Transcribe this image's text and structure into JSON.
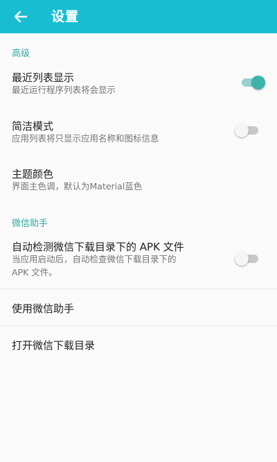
{
  "toolbar": {
    "title": "设置",
    "back_icon": "arrow-left-icon",
    "background": "#19bdd1"
  },
  "sections": {
    "advanced": {
      "header": "高级",
      "recent_list": {
        "title": "最近列表显示",
        "summary": "最近运行程序列表将会显示",
        "enabled": true
      },
      "simple_mode": {
        "title": "简洁模式",
        "summary": "应用列表将只显示应用名称和图标信息",
        "enabled": false
      },
      "theme_color": {
        "title": "主题颜色",
        "summary": "界面主色调，默认为Material蓝色"
      }
    },
    "wechat": {
      "header": "微信助手",
      "auto_detect": {
        "title": "自动检测微信下载目录下的 APK 文件",
        "summary_line1": "当应用启动后，自动检查微信下载目录下的",
        "summary_line2": "APK 文件。",
        "enabled": false
      },
      "use_assistant": {
        "title": "使用微信助手"
      },
      "open_download_dir": {
        "title": "打开微信下载目录"
      }
    }
  },
  "colors": {
    "accent": "#34a9a3",
    "switch_on_thumb": "#3ab4a9",
    "switch_on_track": "#96d4cf"
  }
}
